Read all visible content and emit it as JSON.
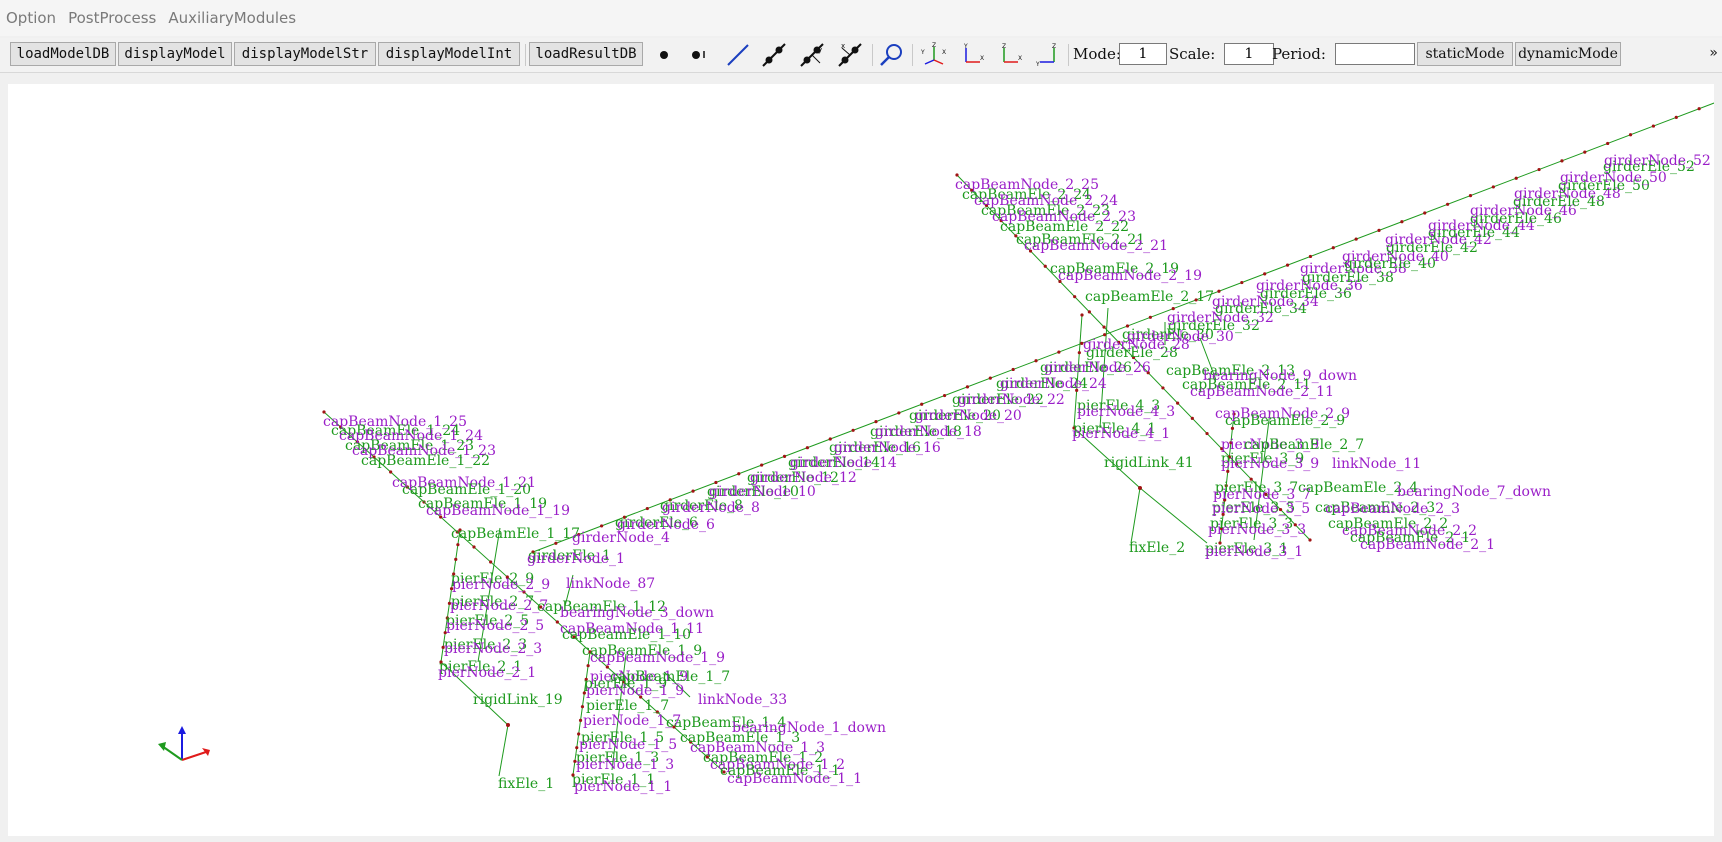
{
  "menu": [
    "Option",
    "PostProcess",
    "AuxiliaryModules"
  ],
  "toolbar": {
    "buttons": {
      "load_model_db": "loadModelDB",
      "display_model": "displayModel",
      "display_model_str": "displayModelStr",
      "display_model_int": "displayModelInt",
      "load_result_db": "loadResultDB",
      "static_mode": "staticMode",
      "dynamic_mode": "dynamicMode"
    },
    "icons": [
      "node-dot-icon",
      "node-label-icon",
      "line-icon",
      "element-icon",
      "element-local-axis-icon",
      "element-axis-2-icon",
      "zoom-icon",
      "view-yz-icon",
      "view-xy-icon",
      "view-xz-icon",
      "view-3d-icon"
    ],
    "mode_label": "Mode:",
    "mode_value": "1",
    "scale_label": "Scale:",
    "scale_value": "1",
    "period_label": "Period:",
    "period_value": "",
    "overflow": "»"
  },
  "colors": {
    "element_line": "#1e9a1e",
    "element_label": "#1e9a1e",
    "node_label": "#9a1ec8",
    "node_point": "#a01414",
    "axis_x": "#e01b1b",
    "axis_y": "#1b1be0",
    "axis_z": "#1e9a1e"
  },
  "labels": [
    {
      "t": "capBeamNode_2_25",
      "c": "p"
    },
    {
      "t": "capBeamEle_2_24",
      "c": "g"
    },
    {
      "t": "capBeamNode_2_24",
      "c": "p"
    },
    {
      "t": "capBeamEle_2_23",
      "c": "g"
    },
    {
      "t": "capBeamNode_2_23",
      "c": "p"
    },
    {
      "t": "capBeamEle_2_22",
      "c": "g"
    },
    {
      "t": "capBeamEle_2_21",
      "c": "g"
    },
    {
      "t": "capBeamNode_2_21",
      "c": "p"
    },
    {
      "t": "capBeamEle_2_19",
      "c": "g"
    },
    {
      "t": "capBeamNode_2_19",
      "c": "p"
    },
    {
      "t": "capBeamEle_2_17",
      "c": "g"
    },
    {
      "t": "capBeamEle_2_13",
      "c": "g"
    },
    {
      "t": "bearingNode_9_down",
      "c": "p"
    },
    {
      "t": "capBeamEle_2_11",
      "c": "g"
    },
    {
      "t": "capBeamNode_2_11",
      "c": "p"
    },
    {
      "t": "capBeamNode_2_9",
      "c": "p"
    },
    {
      "t": "capBeamEle_2_9",
      "c": "g"
    },
    {
      "t": "pierNode_3_9",
      "c": "p"
    },
    {
      "t": "capBeamEle_2_7",
      "c": "g"
    },
    {
      "t": "pierEle_3_9",
      "c": "g"
    },
    {
      "t": "pierNode_3_9",
      "c": "p"
    },
    {
      "t": "linkNode_11",
      "c": "p"
    },
    {
      "t": "pierEle_3_7",
      "c": "g"
    },
    {
      "t": "pierNode_3_7",
      "c": "p"
    },
    {
      "t": "capBeamEle_2_4",
      "c": "g"
    },
    {
      "t": "bearingNode_7_down",
      "c": "p"
    },
    {
      "t": "pierEle_3_5",
      "c": "g"
    },
    {
      "t": "capBeamEle_2_3",
      "c": "g"
    },
    {
      "t": "pierNode_3_5",
      "c": "p"
    },
    {
      "t": "capBeamNode_2_3",
      "c": "p"
    },
    {
      "t": "capBeamEle_2_2",
      "c": "g"
    },
    {
      "t": "pierEle_3_3",
      "c": "g"
    },
    {
      "t": "capBeamNode_2_2",
      "c": "p"
    },
    {
      "t": "pierNode_3_3",
      "c": "p"
    },
    {
      "t": "capBeamEle_2_1",
      "c": "g"
    },
    {
      "t": "pierEle_3_1",
      "c": "g"
    },
    {
      "t": "capBeamNode_2_1",
      "c": "p"
    },
    {
      "t": "pierNode_3_1",
      "c": "p"
    },
    {
      "t": "fixEle_2",
      "c": "g"
    },
    {
      "t": "pierEle_4_3",
      "c": "g"
    },
    {
      "t": "pierNode_4_3",
      "c": "p"
    },
    {
      "t": "pierEle_4_1",
      "c": "g"
    },
    {
      "t": "pierNode_4_1",
      "c": "p"
    },
    {
      "t": "rigidLink_41",
      "c": "g"
    },
    {
      "t": "capBeamNode_1_25",
      "c": "p"
    },
    {
      "t": "capBeamEle_1_24",
      "c": "g"
    },
    {
      "t": "capBeamNode_1_24",
      "c": "p"
    },
    {
      "t": "capBeamEle_1_23",
      "c": "g"
    },
    {
      "t": "capBeamNode_1_23",
      "c": "p"
    },
    {
      "t": "capBeamEle_1_22",
      "c": "g"
    },
    {
      "t": "capBeamNode_1_21",
      "c": "p"
    },
    {
      "t": "capBeamEle_1_20",
      "c": "g"
    },
    {
      "t": "capBeamEle_1_19",
      "c": "g"
    },
    {
      "t": "capBeamNode_1_19",
      "c": "p"
    },
    {
      "t": "capBeamEle_1_17",
      "c": "g"
    },
    {
      "t": "girderEle_1",
      "c": "g"
    },
    {
      "t": "girderNode_1",
      "c": "p"
    },
    {
      "t": "linkNode_87",
      "c": "p"
    },
    {
      "t": "pierEle_2_9",
      "c": "g"
    },
    {
      "t": "pierNode_2_9",
      "c": "p"
    },
    {
      "t": "pierEle_2_7",
      "c": "g"
    },
    {
      "t": "capBeamEle_1_12",
      "c": "g"
    },
    {
      "t": "pierNode_2_7",
      "c": "p"
    },
    {
      "t": "bearingNode_3_down",
      "c": "p"
    },
    {
      "t": "pierEle_2_5",
      "c": "g"
    },
    {
      "t": "capBeamNode_1_11",
      "c": "p"
    },
    {
      "t": "pierNode_2_5",
      "c": "p"
    },
    {
      "t": "capBeamEle_1_10",
      "c": "g"
    },
    {
      "t": "pierEle_2_3",
      "c": "g"
    },
    {
      "t": "pierNode_2_3",
      "c": "p"
    },
    {
      "t": "capBeamEle_1_9",
      "c": "g"
    },
    {
      "t": "capBeamNode_1_9",
      "c": "p"
    },
    {
      "t": "pierEle_2_1",
      "c": "g"
    },
    {
      "t": "pierNode_2_1",
      "c": "p"
    },
    {
      "t": "pierNode_1_9",
      "c": "p"
    },
    {
      "t": "capBeamEle_1_7",
      "c": "g"
    },
    {
      "t": "pierEle_1_9",
      "c": "g"
    },
    {
      "t": "pierNode_1_9",
      "c": "p"
    },
    {
      "t": "linkNode_33",
      "c": "p"
    },
    {
      "t": "rigidLink_19",
      "c": "g"
    },
    {
      "t": "pierEle_1_7",
      "c": "g"
    },
    {
      "t": "capBeamEle_1_4",
      "c": "g"
    },
    {
      "t": "pierNode_1_7",
      "c": "p"
    },
    {
      "t": "bearingNode_1_down",
      "c": "p"
    },
    {
      "t": "pierEle_1_5",
      "c": "g"
    },
    {
      "t": "capBeamEle_1_3",
      "c": "g"
    },
    {
      "t": "pierNode_1_5",
      "c": "p"
    },
    {
      "t": "capBeamNode_1_3",
      "c": "p"
    },
    {
      "t": "capBeamEle_1_2",
      "c": "g"
    },
    {
      "t": "pierEle_1_3",
      "c": "g"
    },
    {
      "t": "capBeamNode_1_2",
      "c": "p"
    },
    {
      "t": "pierNode_1_3",
      "c": "p"
    },
    {
      "t": "capBeamEle_1_1",
      "c": "g"
    },
    {
      "t": "pierEle_1_1",
      "c": "g"
    },
    {
      "t": "capBeamNode_1_1",
      "c": "p"
    },
    {
      "t": "pierNode_1_1",
      "c": "p"
    },
    {
      "t": "fixEle_1",
      "c": "g"
    },
    {
      "t": "girderNode_4",
      "c": "p"
    },
    {
      "t": "girderEle_6",
      "c": "g"
    },
    {
      "t": "girderNode_6",
      "c": "p"
    },
    {
      "t": "girderEle_8",
      "c": "g"
    },
    {
      "t": "girderNode_8",
      "c": "p"
    },
    {
      "t": "girderEle_10",
      "c": "g"
    },
    {
      "t": "girderNode_10",
      "c": "p"
    },
    {
      "t": "girderEle_12",
      "c": "g"
    },
    {
      "t": "girderNode_12",
      "c": "p"
    },
    {
      "t": "girderEle_14",
      "c": "g"
    },
    {
      "t": "girderNode_14",
      "c": "p"
    },
    {
      "t": "girderEle_16",
      "c": "g"
    },
    {
      "t": "girderNode_16",
      "c": "p"
    },
    {
      "t": "girderEle_18",
      "c": "g"
    },
    {
      "t": "girderNode_18",
      "c": "p"
    },
    {
      "t": "girderEle_20",
      "c": "g"
    },
    {
      "t": "girderNode_20",
      "c": "p"
    },
    {
      "t": "girderEle_22",
      "c": "g"
    },
    {
      "t": "girderNode_22",
      "c": "p"
    },
    {
      "t": "girderEle_24",
      "c": "g"
    },
    {
      "t": "girderNode_24",
      "c": "p"
    },
    {
      "t": "girderEle_26",
      "c": "g"
    },
    {
      "t": "girderNode_26",
      "c": "p"
    },
    {
      "t": "girderEle_28",
      "c": "g"
    },
    {
      "t": "girderNode_28",
      "c": "p"
    },
    {
      "t": "girderEle_30",
      "c": "g"
    },
    {
      "t": "girderNode_30",
      "c": "p"
    },
    {
      "t": "girderEle_32",
      "c": "g"
    },
    {
      "t": "girderNode_32",
      "c": "p"
    },
    {
      "t": "girderEle_34",
      "c": "g"
    },
    {
      "t": "girderNode_34",
      "c": "p"
    },
    {
      "t": "girderEle_36",
      "c": "g"
    },
    {
      "t": "girderNode_36",
      "c": "p"
    },
    {
      "t": "girderEle_38",
      "c": "g"
    },
    {
      "t": "girderNode_38",
      "c": "p"
    },
    {
      "t": "girderEle_40",
      "c": "g"
    },
    {
      "t": "girderNode_40",
      "c": "p"
    },
    {
      "t": "girderEle_42",
      "c": "g"
    },
    {
      "t": "girderNode_42",
      "c": "p"
    },
    {
      "t": "girderEle_44",
      "c": "g"
    },
    {
      "t": "girderNode_44",
      "c": "p"
    },
    {
      "t": "girderEle_46",
      "c": "g"
    },
    {
      "t": "girderNode_46",
      "c": "p"
    },
    {
      "t": "girderEle_48",
      "c": "g"
    },
    {
      "t": "girderNode_48",
      "c": "p"
    },
    {
      "t": "girderEle_50",
      "c": "g"
    },
    {
      "t": "girderNode_50",
      "c": "p"
    },
    {
      "t": "girderEle_52",
      "c": "g"
    },
    {
      "t": "girderNode_52",
      "c": "p"
    }
  ]
}
